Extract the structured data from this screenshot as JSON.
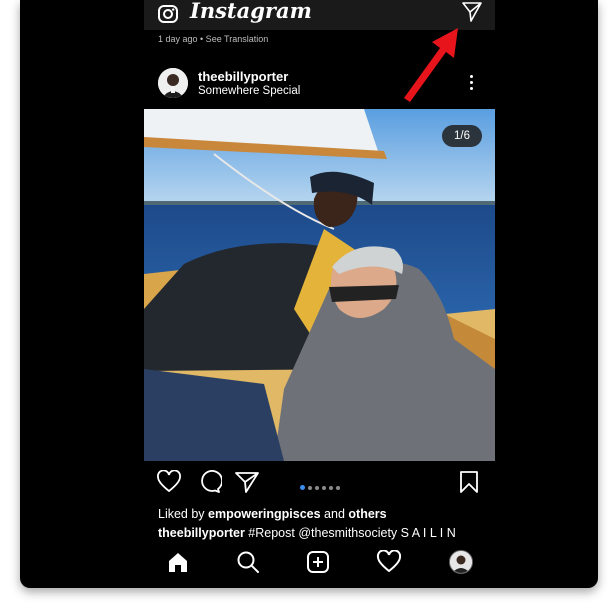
{
  "app": {
    "title": "Instagram"
  },
  "topbar": {
    "camera_icon": "camera-icon",
    "direct_icon": "paper-plane-icon"
  },
  "meta_line": "1 day ago • See Translation",
  "post": {
    "username": "theebillyporter",
    "location": "Somewhere Special",
    "counter": "1/6",
    "likes_prefix": "Liked by ",
    "likes_user": "empoweringpisces",
    "likes_and": " and ",
    "likes_others": "others",
    "caption_user": "theebillyporter",
    "caption_text": " #Repost @thesmithsociety S A I L I N",
    "carousel": {
      "count": 6,
      "active": 0
    }
  },
  "nav": {
    "items": [
      "home-icon",
      "search-icon",
      "add-post-icon",
      "activity-heart-icon",
      "profile-avatar"
    ]
  },
  "annotation": {
    "arrow_color": "#e8141c"
  }
}
